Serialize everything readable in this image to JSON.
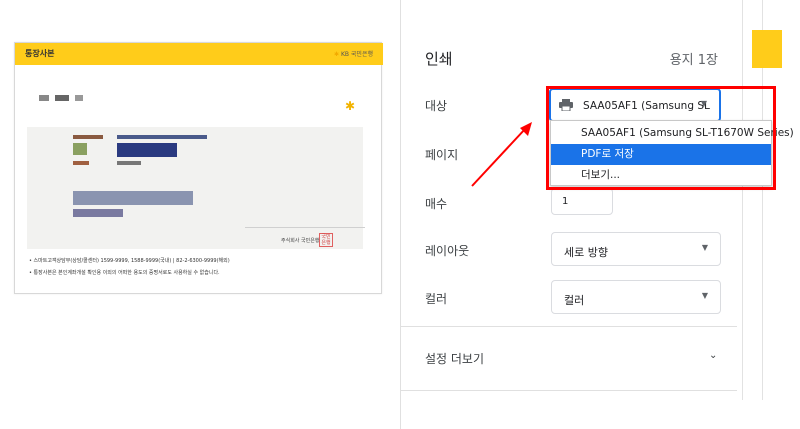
{
  "preview": {
    "doc_title": "통장사본",
    "brand": "KB 국민은행",
    "bank_name": "주식회사 국민은행",
    "seal_text": "국민은행",
    "note1": "• 스마트고객상담부(상담/콜센터) 1599-9999, 1588-9999(국내) | 82-2-6300-9999(해외)",
    "note2": "• 통장사본은 본인계좌개설 확인용 이외의 어떠한 용도의 증명서로도 사용하실 수 없습니다."
  },
  "dialog": {
    "title": "인쇄",
    "page_count": "용지 1장",
    "rows": {
      "destination_label": "대상",
      "pages_label": "페이지",
      "copies_label": "매수",
      "layout_label": "레이아웃",
      "color_label": "컬러"
    },
    "destination_value": "SAA05AF1 (Samsung SL",
    "copies_value": "1",
    "layout_value": "세로 방향",
    "color_value": "컬러",
    "more_settings": "설정 더보기"
  },
  "dropdown": {
    "options": [
      "SAA05AF1 (Samsung SL-T1670W Series)",
      "PDF로 저장",
      "더보기..."
    ],
    "selected_index": 1
  },
  "colors": {
    "accent": "#1a73e8",
    "kb_yellow": "#ffcc1a",
    "highlight_red": "#ff0000"
  }
}
